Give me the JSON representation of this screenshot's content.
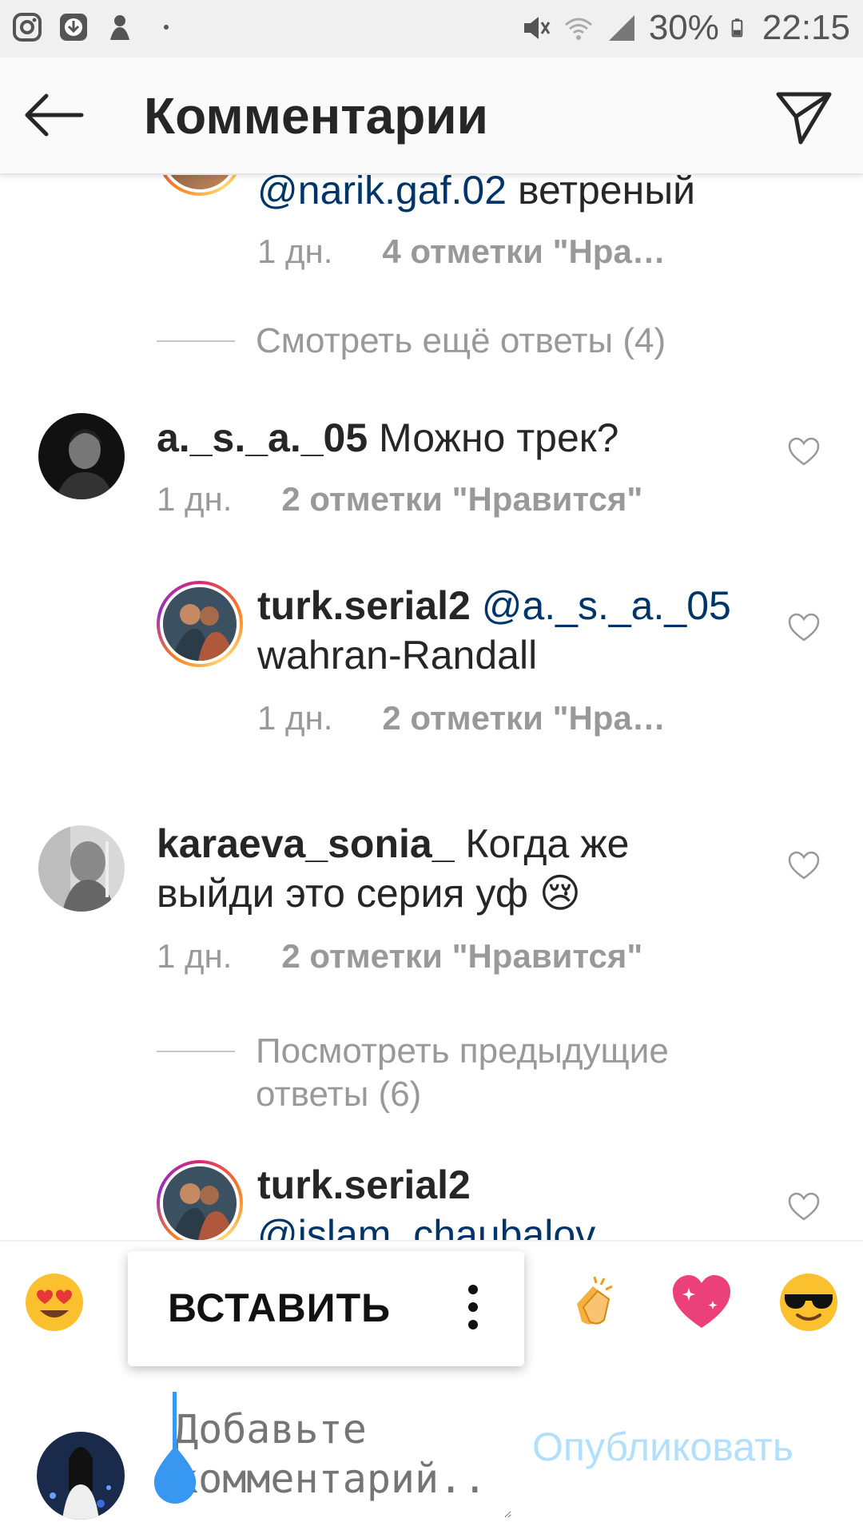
{
  "status_bar": {
    "battery": "30%",
    "time": "22:15",
    "icons": [
      "instagram-icon",
      "download-icon",
      "notification-icon",
      "mute-icon",
      "wifi-icon",
      "signal-icon",
      "battery-icon"
    ]
  },
  "header": {
    "title": "Комментарии",
    "back_icon": "arrow-left-icon",
    "send_icon": "direct-send-icon"
  },
  "comments": [
    {
      "text_partial": "@narik.gaf.02",
      "text_rest": " ветреный",
      "time": "1 дн.",
      "likes": "4 отметки \"Нра…"
    },
    {
      "view_more": "Смотреть ещё ответы (4)"
    },
    {
      "username": "a._s._a._05",
      "text": " Можно трек?",
      "time": "1 дн.",
      "likes": "2 отметки \"Нравится\""
    },
    {
      "username": "turk.serial2",
      "mention": " @a._s._a._05",
      "text": "wahran-Randall",
      "time": "1 дн.",
      "likes": "2 отметки \"Нра…"
    },
    {
      "username": "karaeva_sonia_",
      "text": " Когда же выйди это серия уф 😢",
      "time": "1 дн.",
      "likes": "2 отметки \"Нравится\""
    },
    {
      "view_more": "Посмотреть предыдущие ответы (6)"
    },
    {
      "username": "turk.serial2",
      "mention": "@islam_chaubalov"
    }
  ],
  "emoji_bar": [
    "😍",
    "👏",
    "💖",
    "😎"
  ],
  "paste_popup": {
    "paste_label": "ВСТАВИТЬ"
  },
  "composer": {
    "placeholder": "Добавьте комментарий...",
    "publish_label": "Опубликовать"
  },
  "colors": {
    "mention": "#003569",
    "meta": "#999999",
    "publish_disabled": "#b2dffc",
    "caret": "#3897f0"
  }
}
